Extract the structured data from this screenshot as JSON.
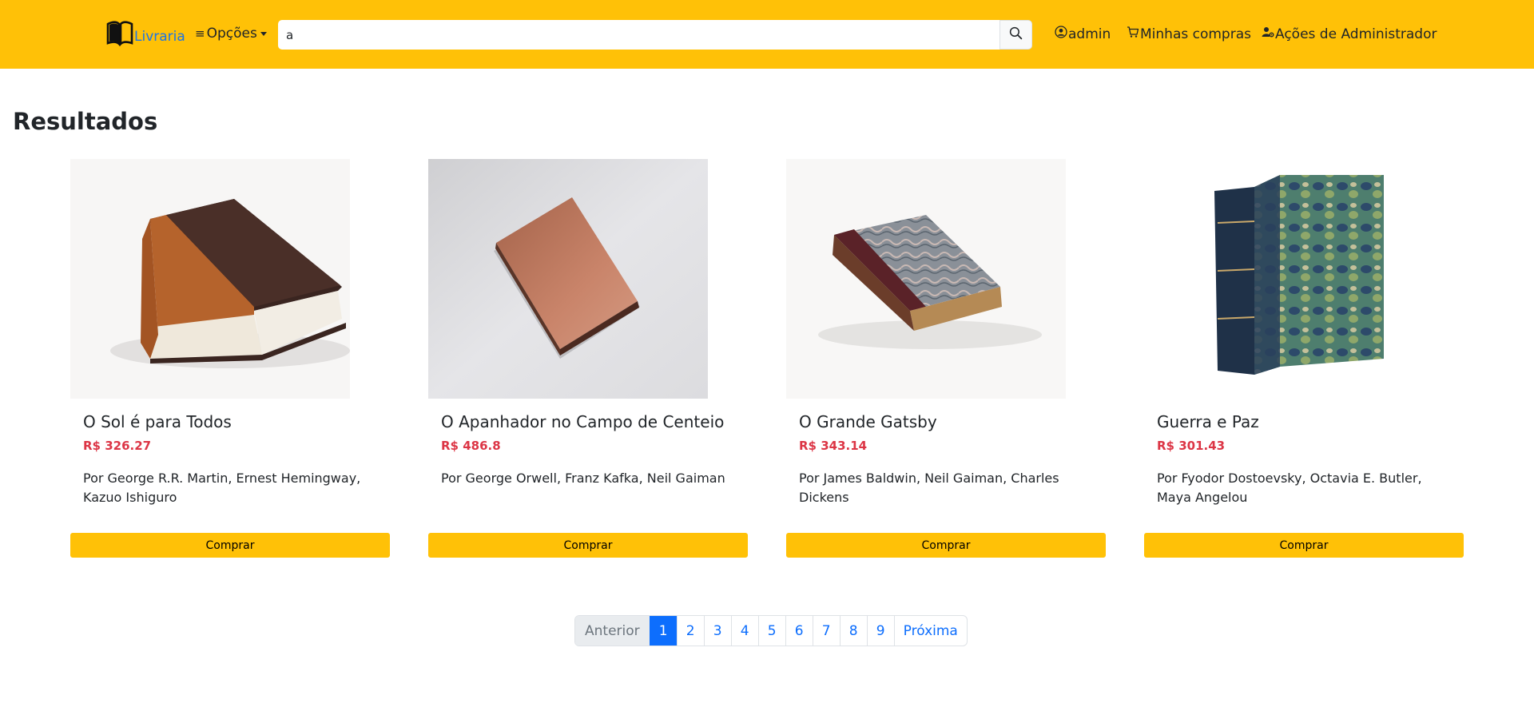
{
  "brand": {
    "name": "Livraria",
    "icon": "book-icon"
  },
  "navbar": {
    "options_label": "Opções",
    "search_value": "a",
    "search_icon": "search-icon",
    "user_label": "admin",
    "purchases_label": "Minhas compras",
    "admin_actions_label": "Ações de Administrador"
  },
  "results": {
    "heading": "Resultados",
    "buy_label": "Comprar",
    "books": [
      {
        "title": "O Sol é para Todos",
        "price": "R$ 326.27",
        "authors": "Por George R.R. Martin, Ernest Hemingway, Kazuo Ishiguro"
      },
      {
        "title": "O Apanhador no Campo de Centeio",
        "price": "R$ 486.8",
        "authors": "Por George Orwell, Franz Kafka, Neil Gaiman"
      },
      {
        "title": "O Grande Gatsby",
        "price": "R$ 343.14",
        "authors": "Por James Baldwin, Neil Gaiman, Charles Dickens"
      },
      {
        "title": "Guerra e Paz",
        "price": "R$ 301.43",
        "authors": "Por Fyodor Dostoevsky, Octavia E. Butler, Maya Angelou"
      }
    ]
  },
  "pagination": {
    "previous": "Anterior",
    "next": "Próxima",
    "pages": [
      "1",
      "2",
      "3",
      "4",
      "5",
      "6",
      "7",
      "8",
      "9"
    ],
    "current": "1"
  },
  "colors": {
    "accent": "#ffc107",
    "price": "#dc3545",
    "link": "#0d6efd"
  }
}
